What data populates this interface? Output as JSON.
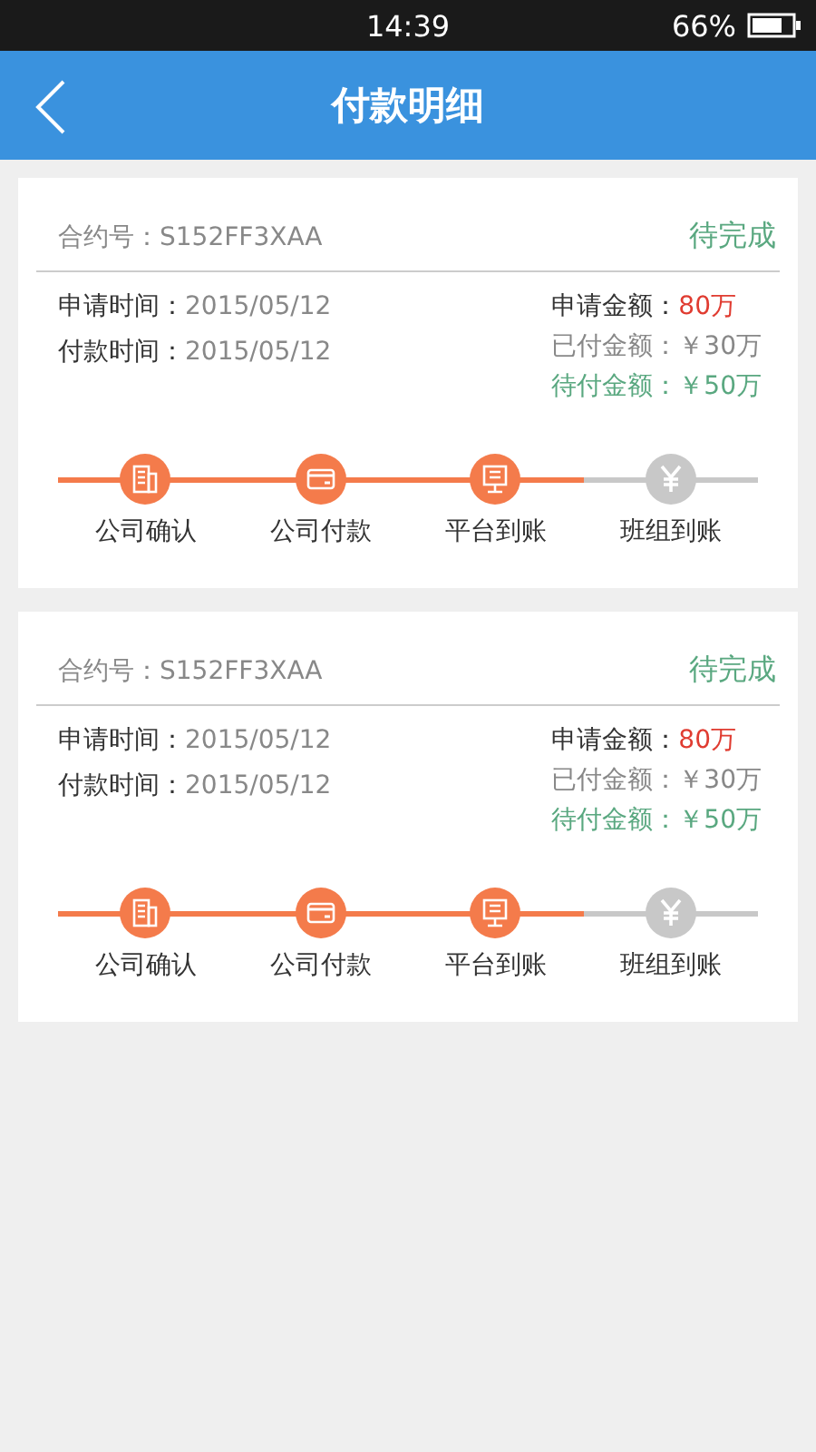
{
  "status_bar": {
    "time": "14:39",
    "battery": "66%"
  },
  "header": {
    "title": "付款明细"
  },
  "cards": [
    {
      "contract": "合约号：S152FF3XAA",
      "status": "待完成",
      "times": [
        {
          "label": "申请时间：",
          "value": "2015/05/12"
        },
        {
          "label": "付款时间：",
          "value": "2015/05/12"
        }
      ],
      "amounts": [
        {
          "kind": "total",
          "label": "申请金额：",
          "value": "80万"
        },
        {
          "kind": "paid",
          "label": "已付金额：",
          "value": "￥30万"
        },
        {
          "kind": "pending",
          "label": "待付金额：",
          "value": "￥50万"
        }
      ],
      "steps": [
        {
          "label": "公司确认",
          "done": true
        },
        {
          "label": "公司付款",
          "done": true
        },
        {
          "label": "平台到账",
          "done": true
        },
        {
          "label": "班组到账",
          "done": false
        }
      ]
    },
    {
      "contract": "合约号：S152FF3XAA",
      "status": "待完成",
      "times": [
        {
          "label": "申请时间：",
          "value": "2015/05/12"
        },
        {
          "label": "付款时间：",
          "value": "2015/05/12"
        }
      ],
      "amounts": [
        {
          "kind": "total",
          "label": "申请金额：",
          "value": "80万"
        },
        {
          "kind": "paid",
          "label": "已付金额：",
          "value": "￥30万"
        },
        {
          "kind": "pending",
          "label": "待付金额：",
          "value": "￥50万"
        }
      ],
      "steps": [
        {
          "label": "公司确认",
          "done": true
        },
        {
          "label": "公司付款",
          "done": true
        },
        {
          "label": "平台到账",
          "done": true
        },
        {
          "label": "班组到账",
          "done": false
        }
      ]
    }
  ]
}
